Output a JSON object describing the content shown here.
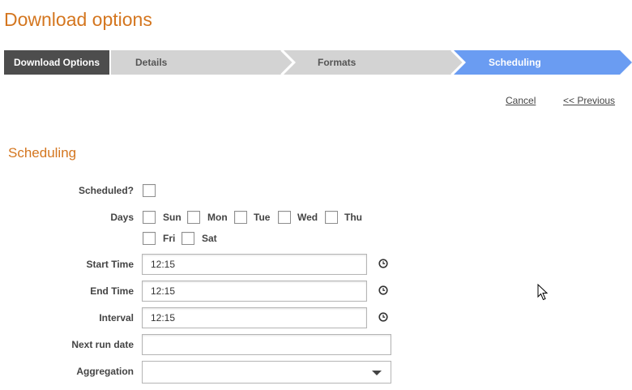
{
  "page": {
    "title": "Download options"
  },
  "wizard": {
    "steps": [
      {
        "label": "Download Options",
        "state": "current-section"
      },
      {
        "label": "Details",
        "state": "inactive"
      },
      {
        "label": "Formats",
        "state": "inactive"
      },
      {
        "label": "Scheduling",
        "state": "active"
      }
    ],
    "colors": {
      "section": "#4d4d4d",
      "inactive": "#d3d3d3",
      "active": "#6a9cf2",
      "title": "#d4761f"
    }
  },
  "actions": {
    "cancel": "Cancel",
    "previous": "<< Previous"
  },
  "section": {
    "title": "Scheduling"
  },
  "form": {
    "scheduled": {
      "label": "Scheduled?",
      "checked": false
    },
    "days": {
      "label": "Days",
      "items": [
        {
          "label": "Sun",
          "checked": false
        },
        {
          "label": "Mon",
          "checked": false
        },
        {
          "label": "Tue",
          "checked": false
        },
        {
          "label": "Wed",
          "checked": false
        },
        {
          "label": "Thu",
          "checked": false
        },
        {
          "label": "Fri",
          "checked": false
        },
        {
          "label": "Sat",
          "checked": false
        }
      ]
    },
    "start_time": {
      "label": "Start Time",
      "value": "12:15",
      "icon": "clock-icon"
    },
    "end_time": {
      "label": "End Time",
      "value": "12:15",
      "icon": "clock-icon"
    },
    "interval": {
      "label": "Interval",
      "value": "12:15",
      "icon": "clock-icon"
    },
    "next_run_date": {
      "label": "Next run date",
      "value": ""
    },
    "aggregation": {
      "label": "Aggregation",
      "value": "",
      "icon": "chevron-down-icon"
    }
  }
}
